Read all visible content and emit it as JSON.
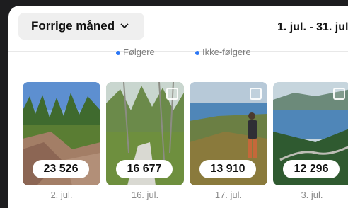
{
  "header": {
    "period_label": "Forrige måned",
    "date_range": "1. jul. - 31. jul."
  },
  "legend": {
    "followers": "Følgere",
    "non_followers": "Ikke-følgere",
    "dot_color": "#2b77f6"
  },
  "posts": [
    {
      "count": "23 526",
      "date": "2. jul."
    },
    {
      "count": "16 677",
      "date": "16. jul."
    },
    {
      "count": "13 910",
      "date": "17. jul."
    },
    {
      "count": "12 296",
      "date": "3. jul."
    }
  ]
}
